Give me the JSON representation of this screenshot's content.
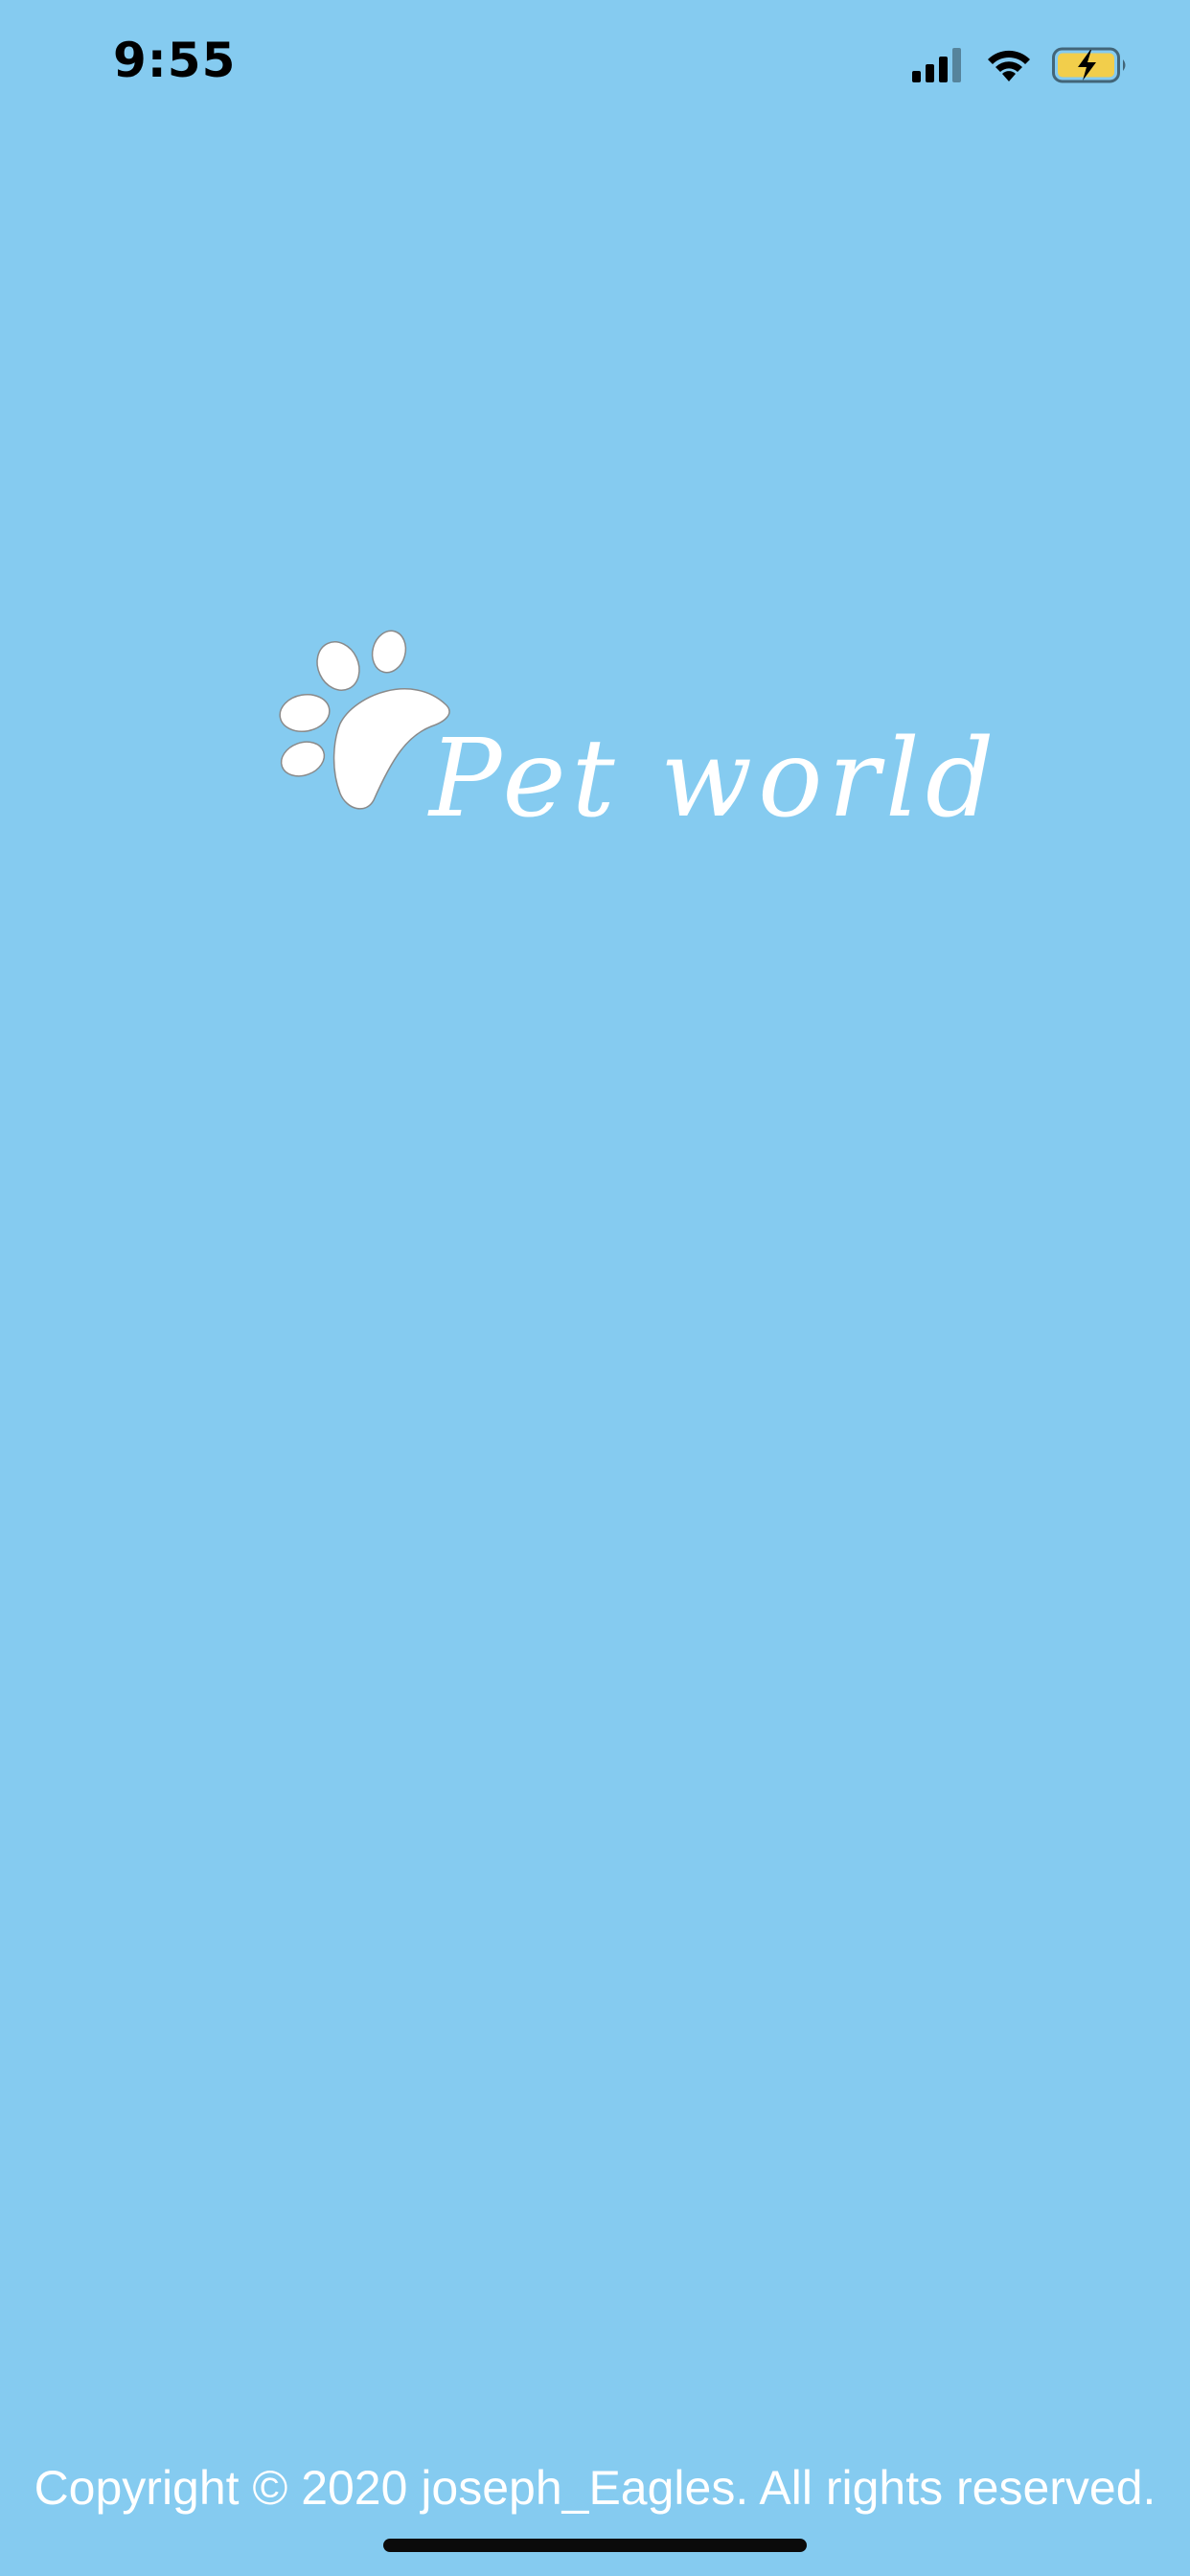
{
  "status_bar": {
    "time": "9:55",
    "icons": [
      "cellular-signal-icon",
      "wifi-icon",
      "battery-charging-icon"
    ],
    "battery_color": "#F2CE4B"
  },
  "splash": {
    "logo_icon": "paw-print-icon",
    "app_name": "Pet world"
  },
  "footer": {
    "copyright": "Copyright © 2020 joseph_Eagles. All rights reserved."
  },
  "colors": {
    "background": "#85CBF0",
    "text": "#FFFFFF"
  }
}
